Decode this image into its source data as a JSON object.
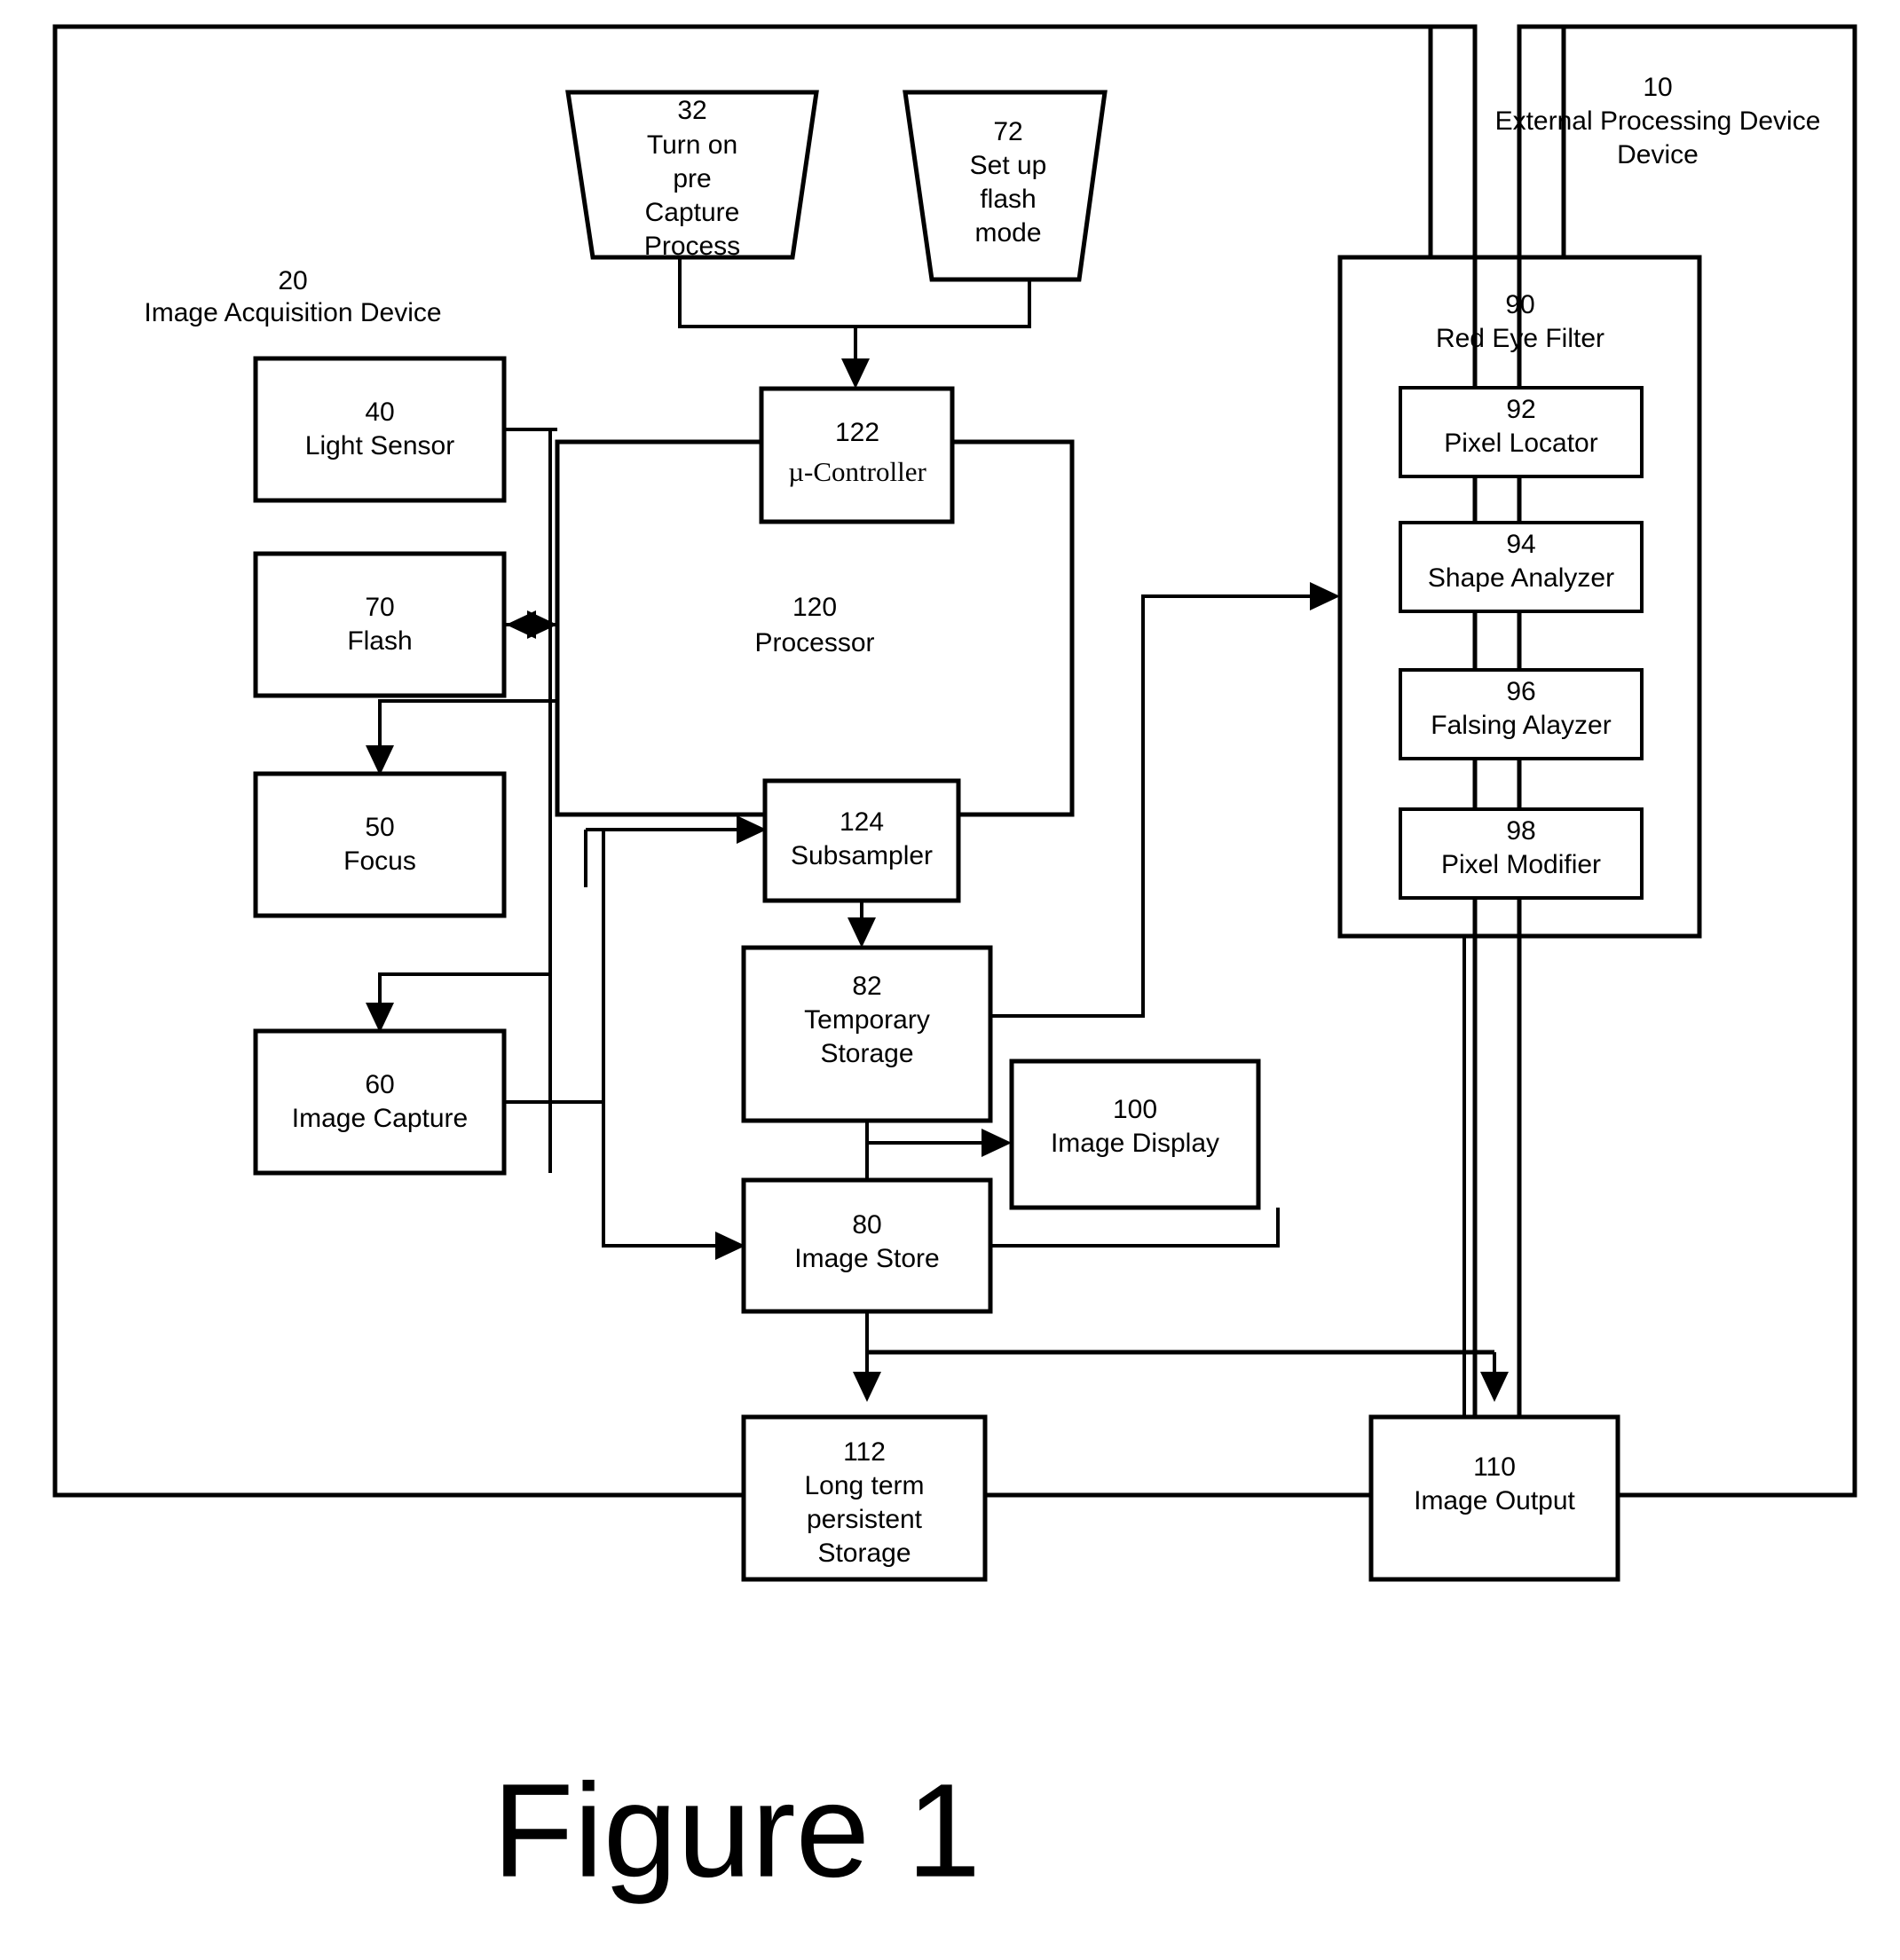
{
  "figure": {
    "caption": "Figure 1"
  },
  "containers": [
    {
      "id": "image-acquisition-device",
      "number": "20",
      "title": "Image Acquisition Device"
    },
    {
      "id": "external-processing-device",
      "number": "10",
      "title": "External Processing Device"
    },
    {
      "id": "red-eye-filter",
      "number": "90",
      "title": "Red Eye Filter"
    }
  ],
  "process_steps": [
    {
      "id": "turn-on-pre-capture-process",
      "number": "32",
      "lines": [
        "Turn on",
        "pre",
        "Capture",
        "Process"
      ]
    },
    {
      "id": "set-up-flash-mode",
      "number": "72",
      "lines": [
        "Set up",
        "flash",
        "mode"
      ]
    }
  ],
  "blocks": [
    {
      "id": "light-sensor",
      "number": "40",
      "lines": [
        "Light Sensor"
      ]
    },
    {
      "id": "flash",
      "number": "70",
      "lines": [
        "Flash"
      ]
    },
    {
      "id": "focus",
      "number": "50",
      "lines": [
        "Focus"
      ]
    },
    {
      "id": "image-capture",
      "number": "60",
      "lines": [
        "Image Capture"
      ]
    },
    {
      "id": "micro-controller",
      "number": "122",
      "lines": [
        "µ-Controller"
      ]
    },
    {
      "id": "processor",
      "number": "120",
      "lines": [
        "Processor"
      ]
    },
    {
      "id": "subsampler",
      "number": "124",
      "lines": [
        "Subsampler"
      ]
    },
    {
      "id": "temporary-storage",
      "number": "82",
      "lines": [
        "Temporary",
        "Storage"
      ]
    },
    {
      "id": "image-store",
      "number": "80",
      "lines": [
        "Image Store"
      ]
    },
    {
      "id": "image-display",
      "number": "100",
      "lines": [
        "Image Display"
      ]
    },
    {
      "id": "long-term-persistent-storage",
      "number": "112",
      "lines": [
        "Long term",
        "persistent",
        "Storage"
      ]
    },
    {
      "id": "image-output",
      "number": "110",
      "lines": [
        "Image Output"
      ]
    }
  ],
  "filter_blocks": [
    {
      "id": "pixel-locator",
      "number": "92",
      "lines": [
        "Pixel Locator"
      ]
    },
    {
      "id": "shape-analyzer",
      "number": "94",
      "lines": [
        "Shape Analyzer"
      ]
    },
    {
      "id": "falsing-alayzer",
      "number": "96",
      "lines": [
        "Falsing Alayzer"
      ]
    },
    {
      "id": "pixel-modifier",
      "number": "98",
      "lines": [
        "Pixel Modifier"
      ]
    }
  ],
  "colors": {
    "ink": "#000000",
    "paper": "#ffffff"
  }
}
